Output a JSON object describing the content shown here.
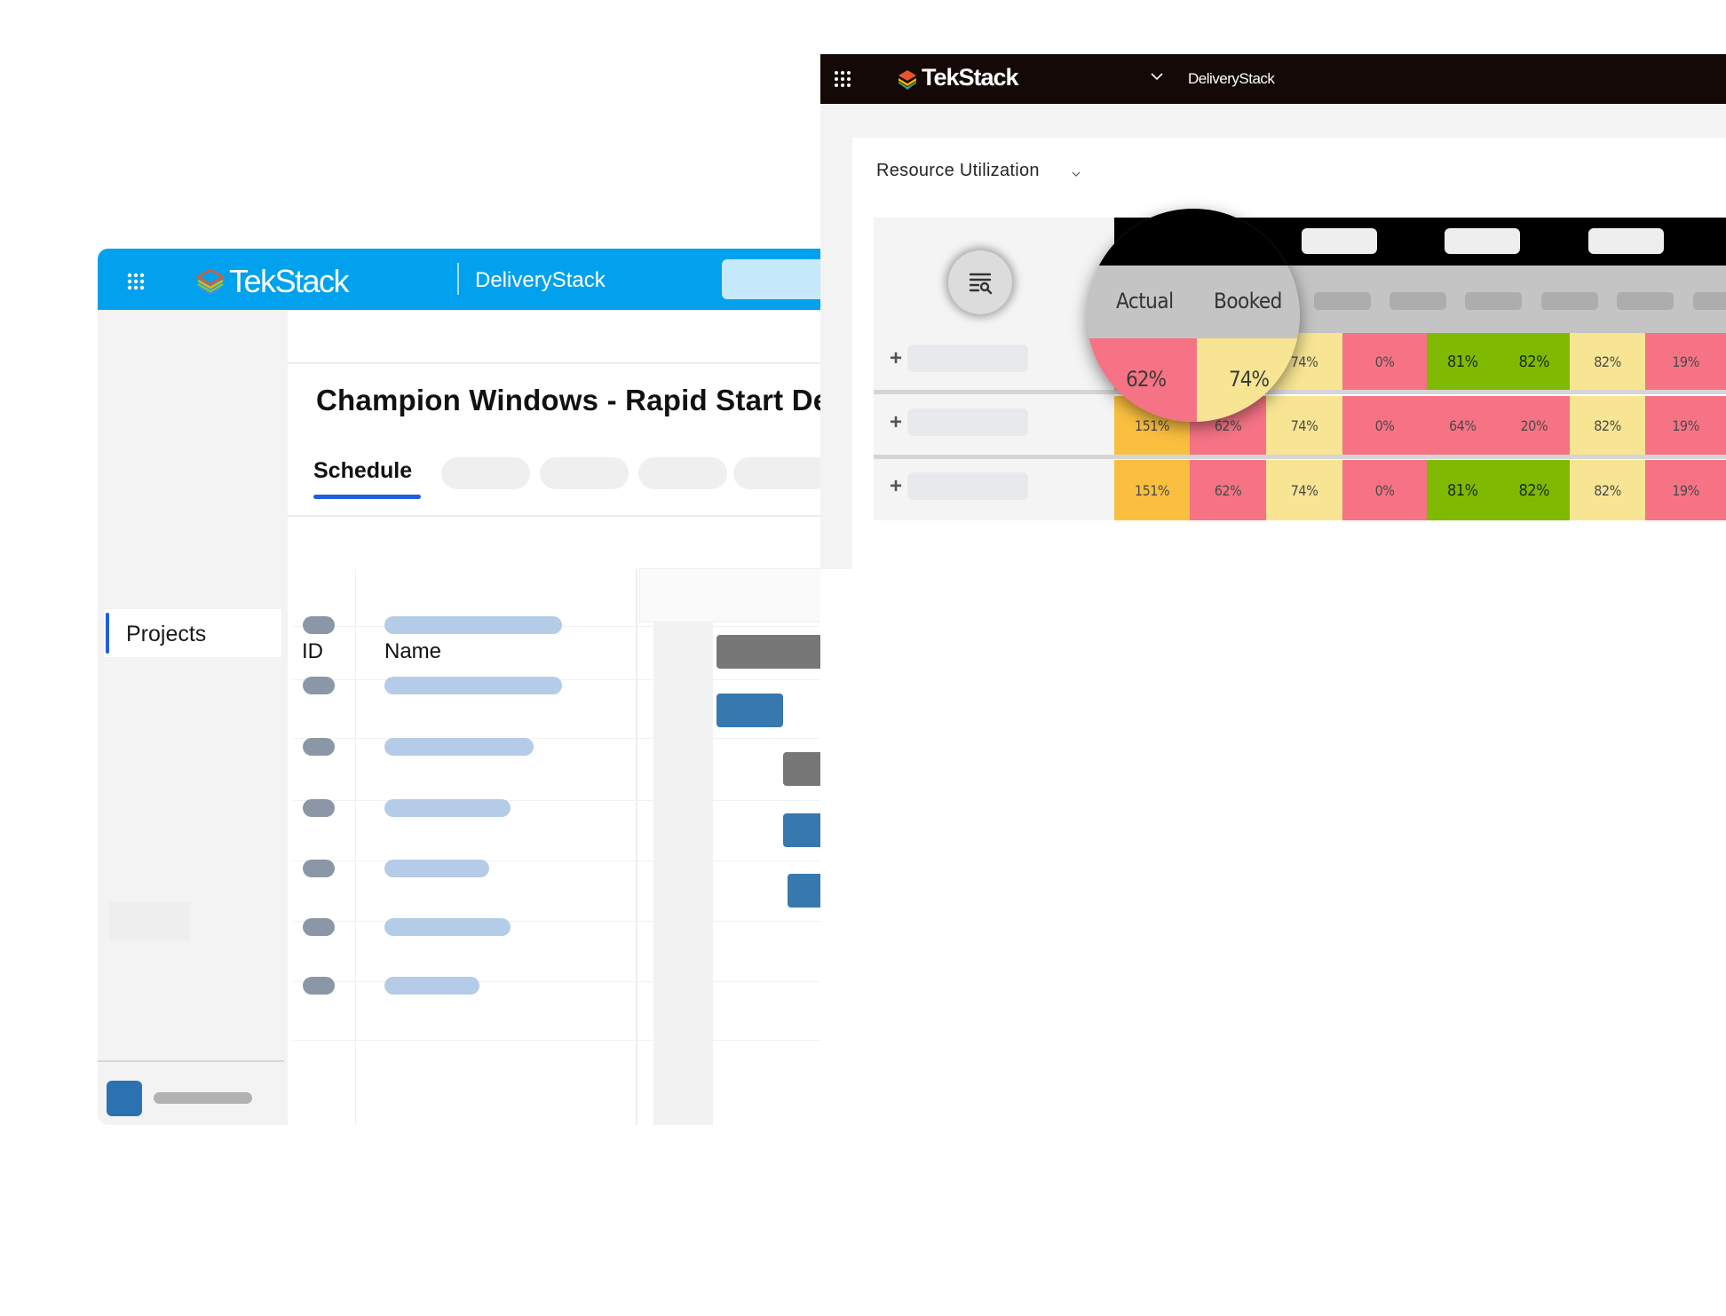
{
  "back_window": {
    "brand": "TekStack",
    "app_name": "DeliveryStack",
    "page_title": "Resource Utilization",
    "icons": {
      "app_launcher": "waffle-grid-icon",
      "logo": "tekstack-logo-icon",
      "dropdown": "chevron-down-icon",
      "filter": "filter-search-icon"
    },
    "heatmap": {
      "lens_headers": [
        "Actual",
        "Booked"
      ],
      "lens_values": [
        "62%",
        "74%"
      ],
      "rows": [
        {
          "cells": [
            {
              "value": "",
              "status": "orange"
            },
            {
              "value": "",
              "status": "red"
            },
            {
              "value": "74%",
              "status": "yellow"
            },
            {
              "value": "0%",
              "status": "red"
            },
            {
              "value": "81%",
              "value2": "82%",
              "status": "green"
            },
            {
              "value": "82%",
              "status": "yellow"
            },
            {
              "value": "19%",
              "status": "red"
            }
          ]
        },
        {
          "cells": [
            {
              "value": "151%",
              "status": "orange"
            },
            {
              "value": "62%",
              "status": "red"
            },
            {
              "value": "74%",
              "status": "yellow"
            },
            {
              "value": "0%",
              "status": "red"
            },
            {
              "value": "64%",
              "value2": "20%",
              "status": "red"
            },
            {
              "value": "82%",
              "status": "yellow"
            },
            {
              "value": "19%",
              "status": "red"
            }
          ]
        },
        {
          "cells": [
            {
              "value": "151%",
              "status": "orange"
            },
            {
              "value": "62%",
              "status": "red"
            },
            {
              "value": "74%",
              "status": "yellow"
            },
            {
              "value": "0%",
              "status": "red"
            },
            {
              "value": "81%",
              "value2": "82%",
              "status": "green"
            },
            {
              "value": "82%",
              "status": "yellow"
            },
            {
              "value": "19%",
              "status": "red"
            }
          ]
        }
      ],
      "expand_symbol": "+",
      "status_colors": {
        "orange": "#fbbf3f",
        "red": "#f67385",
        "yellow": "#f7e593",
        "green": "#7fba00"
      }
    }
  },
  "front_window": {
    "brand": "TekStack",
    "app_name": "DeliveryStack",
    "header_color": "#02a1ee",
    "sidebar": {
      "items": [
        {
          "label": "Projects",
          "active": true
        }
      ]
    },
    "project_title": "Champion Windows - Rapid Start De",
    "tabs": [
      {
        "label": "Schedule",
        "active": true
      }
    ],
    "table": {
      "columns": [
        "ID",
        "Name"
      ],
      "row_count": 7
    },
    "gantt": {
      "bars": [
        {
          "type": "summary",
          "start": 0.0,
          "end": 1.0
        },
        {
          "type": "task",
          "start": 0.0,
          "end": 0.08
        },
        {
          "type": "summary",
          "start": 0.08,
          "end": 0.2
        },
        {
          "type": "task",
          "start": 0.08,
          "end": 0.2
        },
        {
          "type": "task",
          "start": 0.085,
          "end": 0.165
        },
        {
          "type": "task",
          "start": 0.28,
          "end": 0.476
        },
        {
          "type": "task",
          "start": 0.56,
          "end": 0.64
        },
        {
          "type": "task",
          "start": 0.64,
          "end": 1.0
        }
      ],
      "dependencies": [
        [
          5,
          6
        ],
        [
          6,
          7
        ]
      ]
    }
  }
}
